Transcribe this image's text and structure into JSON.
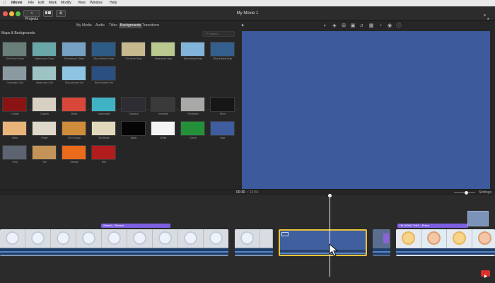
{
  "menubar": {
    "app_name": "iMovie",
    "items": [
      "File",
      "Edit",
      "Mark",
      "Modify",
      "View",
      "Window",
      "Help"
    ]
  },
  "titlebar": {
    "projects_label": "< Projects",
    "title": "My Movie 1"
  },
  "browser": {
    "tabs": [
      "My Media",
      "Audio",
      "Titles",
      "Backgrounds",
      "Transitions"
    ],
    "active_tab": "Backgrounds",
    "section_title": "Maps & Backgrounds",
    "search_placeholder": "Search",
    "maps": [
      {
        "label": "Old World Globe",
        "color": "#6b7f7a"
      },
      {
        "label": "Watercolor Globe",
        "color": "#6aa7a8"
      },
      {
        "label": "Educational Globe",
        "color": "#76a0c4"
      },
      {
        "label": "Blue Marble Globe",
        "color": "#2e5a86"
      },
      {
        "label": "Old World Map",
        "color": "#c6b98e"
      },
      {
        "label": "Watercolor Map",
        "color": "#b9c98f"
      },
      {
        "label": "Educational Map",
        "color": "#82b4d9"
      },
      {
        "label": "Blue Marble Map",
        "color": "#345f8d"
      },
      {
        "label": "Cinematic Grid",
        "color": "#8a9aa0"
      },
      {
        "label": "Watercolor Grid",
        "color": "#9dc3c4"
      },
      {
        "label": "Educational Grid",
        "color": "#8ec3e2"
      },
      {
        "label": "Blue Marble Grid",
        "color": "#2b4f80"
      }
    ],
    "backgrounds": [
      {
        "label": "Curtain",
        "color": "#8a1414"
      },
      {
        "label": "Organic",
        "color": "#d8d0c3"
      },
      {
        "label": "Blobs",
        "color": "#d9473a"
      },
      {
        "label": "Underwater",
        "color": "#3fb3c4"
      },
      {
        "label": "Gradient",
        "color": "#2d2d33"
      },
      {
        "label": "Industrial",
        "color": "#3a3a3a"
      },
      {
        "label": "Pinstripes",
        "color": "#a9aaa8"
      },
      {
        "label": "Ebon",
        "color": "#161616"
      },
      {
        "label": "Silver",
        "color": "#e8b47a"
      },
      {
        "label": "Paper",
        "color": "#ddd8c9"
      },
      {
        "label": "Silk Orange",
        "color": "#cf8c3a"
      },
      {
        "label": "Silk Beige",
        "color": "#e2d9bd"
      },
      {
        "label": "Black",
        "color": "#050505"
      },
      {
        "label": "White",
        "color": "#f4f4f4"
      },
      {
        "label": "Green",
        "color": "#24913a"
      },
      {
        "label": "Blue",
        "color": "#3e5c9e"
      },
      {
        "label": "Grey",
        "color": "#5b6470"
      },
      {
        "label": "Tan",
        "color": "#c49357"
      },
      {
        "label": "Orange",
        "color": "#ea6b1c"
      },
      {
        "label": "Red",
        "color": "#b11c1c"
      }
    ]
  },
  "viewer": {
    "preview_color": "#3c5a9c"
  },
  "timeline": {
    "timecode": "00:30",
    "duration": "/ 12:50",
    "settings_label": "Settings",
    "titles": [
      "Stretch - Reveal",
      "I'M DONE THIS - Prism"
    ],
    "selected_color": "#e9c33a",
    "title_color": "#7d5fe1"
  }
}
